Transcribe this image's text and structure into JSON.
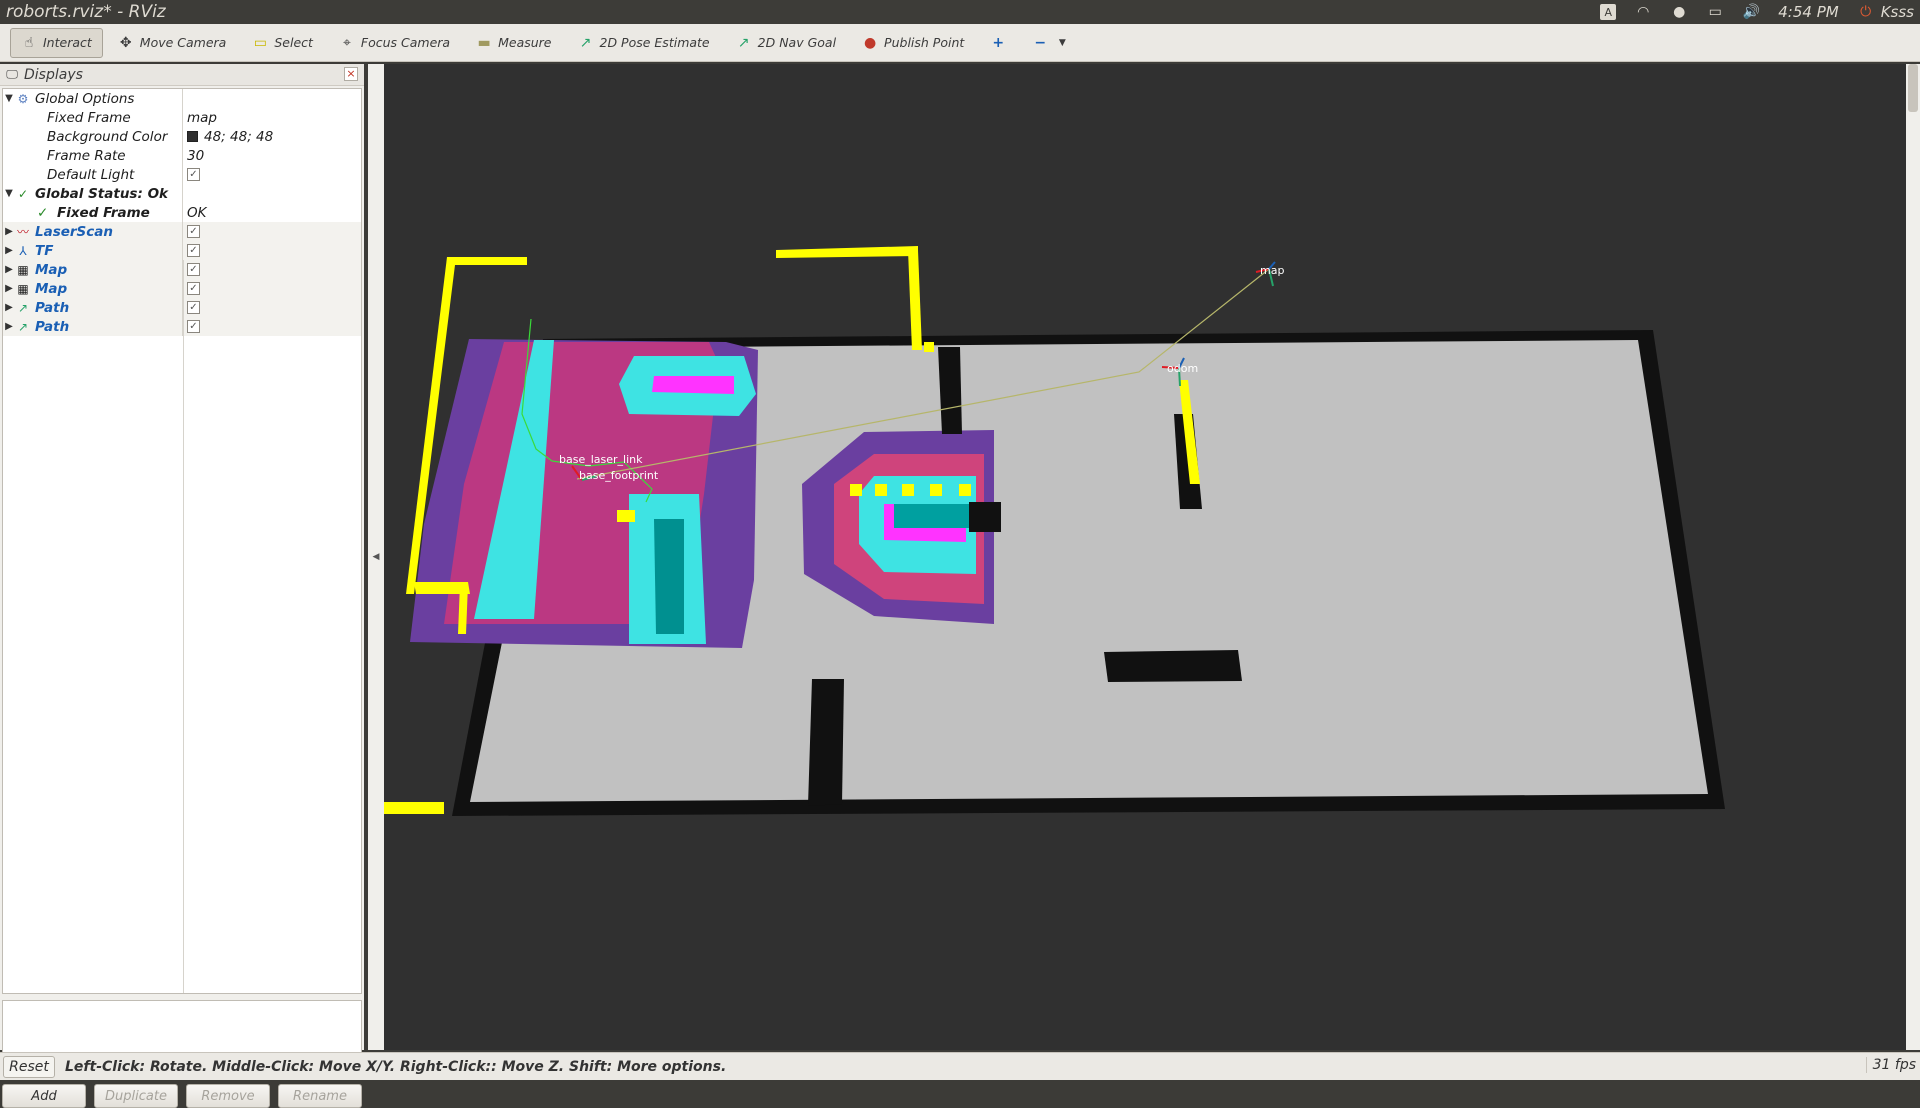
{
  "window": {
    "title": "roborts.rviz* - RViz"
  },
  "system_tray": {
    "keyboard": "A",
    "time": "4:54 PM",
    "user": "Ksss"
  },
  "toolbar": {
    "tools": [
      {
        "label": "Interact",
        "icon": "hand-icon",
        "glyph": "☝",
        "active": true
      },
      {
        "label": "Move Camera",
        "icon": "move-camera-icon",
        "glyph": "✥",
        "active": false
      },
      {
        "label": "Select",
        "icon": "select-icon",
        "glyph": "▭",
        "active": false
      },
      {
        "label": "Focus Camera",
        "icon": "focus-camera-icon",
        "glyph": "⌖",
        "active": false
      },
      {
        "label": "Measure",
        "icon": "measure-icon",
        "glyph": "▬",
        "active": false
      },
      {
        "label": "2D Pose Estimate",
        "icon": "pose-estimate-icon",
        "glyph": "↗",
        "active": false
      },
      {
        "label": "2D Nav Goal",
        "icon": "nav-goal-icon",
        "glyph": "↗",
        "active": false
      },
      {
        "label": "Publish Point",
        "icon": "publish-point-icon",
        "glyph": "📍",
        "active": false
      }
    ]
  },
  "displays_panel": {
    "title": "Displays",
    "global_options": {
      "label": "Global Options",
      "fixed_frame_label": "Fixed Frame",
      "fixed_frame_value": "map",
      "bg_color_label": "Background Color",
      "bg_color_value": "48; 48; 48",
      "frame_rate_label": "Frame Rate",
      "frame_rate_value": "30",
      "default_light_label": "Default Light"
    },
    "global_status": {
      "label": "Global Status: Ok",
      "fixed_frame_label": "Fixed Frame",
      "fixed_frame_value": "OK"
    },
    "displays": [
      {
        "name": "LaserScan",
        "icon": "laserscan-icon",
        "color": "#c01c28"
      },
      {
        "name": "TF",
        "icon": "tf-icon",
        "color": "#1a5fb4"
      },
      {
        "name": "Map",
        "icon": "map-icon",
        "color": "#333333"
      },
      {
        "name": "Map",
        "icon": "map-icon",
        "color": "#333333"
      },
      {
        "name": "Path",
        "icon": "path-icon",
        "color": "#26a269"
      },
      {
        "name": "Path",
        "icon": "path-icon",
        "color": "#26a269"
      }
    ],
    "buttons": {
      "add": "Add",
      "duplicate": "Duplicate",
      "remove": "Remove",
      "rename": "Rename"
    }
  },
  "viewport": {
    "background_color": "#303030",
    "tf_labels": {
      "map": "map",
      "odom": "odom",
      "base_laser": "base_laser_link",
      "base_footprint": "base_footprint"
    }
  },
  "statusbar": {
    "reset": "Reset",
    "hint": "Left-Click: Rotate. Middle-Click: Move X/Y. Right-Click:: Move Z. Shift: More options.",
    "fps": "31 fps"
  }
}
